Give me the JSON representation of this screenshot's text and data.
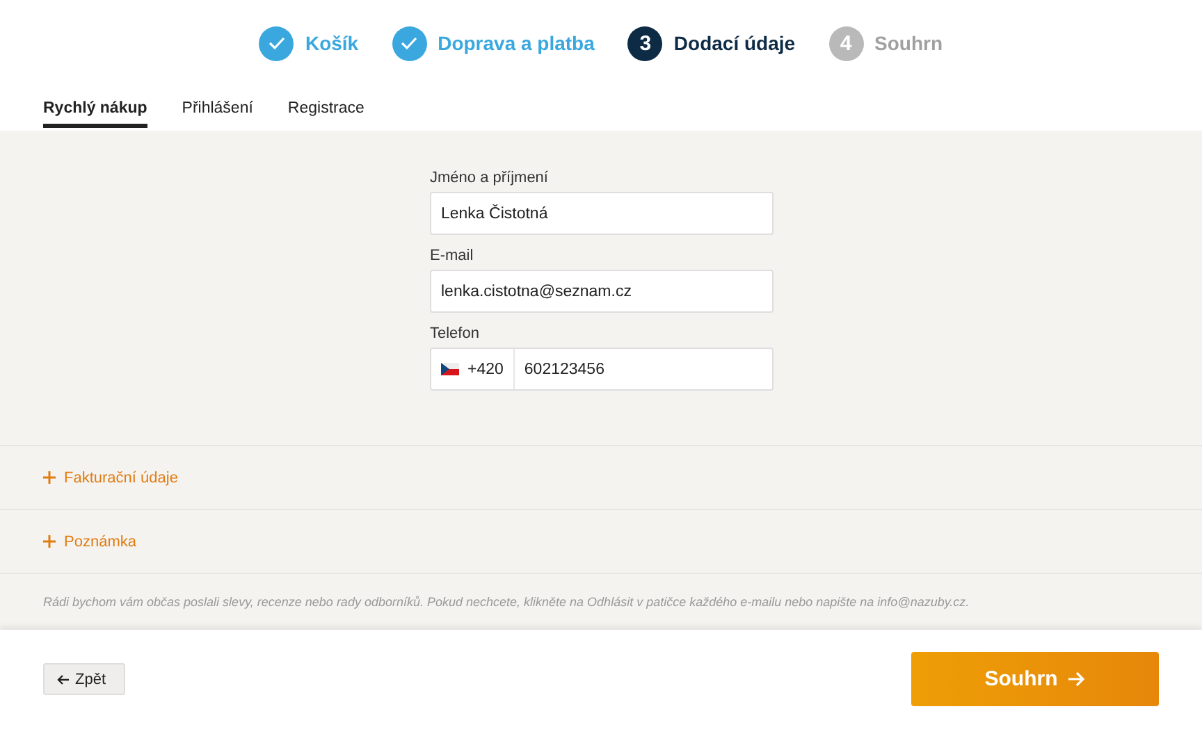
{
  "steps": [
    {
      "label": "Košík",
      "done": true,
      "selected": false
    },
    {
      "label": "Doprava a platba",
      "done": true,
      "selected": false
    },
    {
      "number": "3",
      "label": "Dodací údaje",
      "done": false,
      "selected": true
    },
    {
      "number": "4",
      "label": "Souhrn",
      "done": false,
      "selected": false
    }
  ],
  "tabs": [
    {
      "label": "Rychlý nákup",
      "selected": true
    },
    {
      "label": "Přihlášení",
      "selected": false
    },
    {
      "label": "Registrace",
      "selected": false
    }
  ],
  "fields": [
    {
      "kind": "text",
      "label": "Jméno a příjmení",
      "value": "Lenka Čistotná"
    },
    {
      "kind": "text",
      "label": "E-mail",
      "value": "lenka.cistotna@seznam.cz"
    },
    {
      "kind": "phone",
      "label": "Telefon",
      "prefix": "+420",
      "value": "602123456"
    }
  ],
  "sections": [
    {
      "label": "Fakturační údaje",
      "expanded": false
    },
    {
      "label": "Poznámka",
      "expanded": false
    }
  ],
  "notice": "Rádi bychom vám občas poslali slevy, recenze nebo rady odborníků. Pokud nechcete, klikněte na Odhlásit v patičce každého e-mailu nebo napište na info@nazuby.cz.",
  "back_button": "Zpět",
  "next_button": "Souhrn"
}
